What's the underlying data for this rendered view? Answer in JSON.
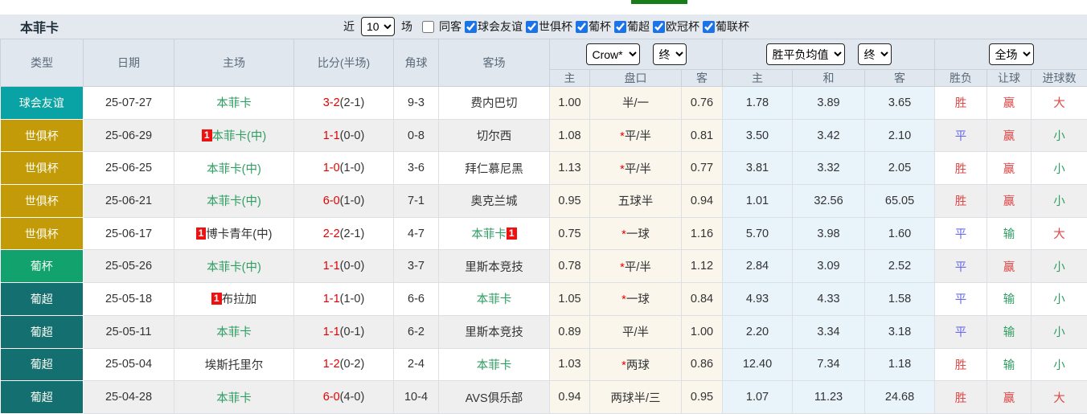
{
  "page": {
    "title": "本菲卡"
  },
  "filters": {
    "recent_label": "近",
    "recent_value": "10",
    "matches_label": "场",
    "away_filter": {
      "label": "同客",
      "checked": false
    },
    "competitions": [
      {
        "label": "球会友谊",
        "checked": true
      },
      {
        "label": "世俱杯",
        "checked": true
      },
      {
        "label": "葡杯",
        "checked": true
      },
      {
        "label": "葡超",
        "checked": true
      },
      {
        "label": "欧冠杯",
        "checked": true
      },
      {
        "label": "葡联杯",
        "checked": true
      }
    ]
  },
  "table": {
    "selects": {
      "company": "Crow*",
      "company_time": "终",
      "avg": "胜平负均值",
      "avg_time": "终",
      "period": "全场"
    },
    "col_headers": {
      "type": "类型",
      "date": "日期",
      "home": "主场",
      "score": "比分(半场)",
      "corners": "角球",
      "away": "客场",
      "ah_home": "主",
      "ah_line": "盘口",
      "ah_away": "客",
      "odds_home": "主",
      "odds_draw": "和",
      "odds_away": "客",
      "result_wdl": "胜负",
      "result_handicap": "让球",
      "result_goals": "进球数"
    },
    "rows": [
      {
        "type": "球会友谊",
        "type_color": "#09a3a5",
        "date": "25-07-27",
        "home": {
          "badge": "",
          "name": "本菲卡",
          "green": true
        },
        "score": {
          "main": "3-2",
          "half": "(2-1)"
        },
        "corners": "9-3",
        "away": {
          "name": "费内巴切",
          "green": false,
          "badge": ""
        },
        "ah": {
          "home": "1.00",
          "star": false,
          "line": "半/一",
          "away": "0.76"
        },
        "odds": {
          "home": "1.78",
          "draw": "3.89",
          "away": "3.65"
        },
        "res": {
          "wdl": {
            "t": "胜",
            "c": "red"
          },
          "handicap": {
            "t": "赢",
            "c": "red"
          },
          "goals": {
            "t": "大",
            "c": "red"
          }
        }
      },
      {
        "type": "世俱杯",
        "type_color": "#c39a08",
        "date": "25-06-29",
        "home": {
          "badge": "1",
          "name": "本菲卡(中)",
          "green": true
        },
        "score": {
          "main": "1-1",
          "half": "(0-0)"
        },
        "corners": "0-8",
        "away": {
          "name": "切尔西",
          "green": false,
          "badge": ""
        },
        "ah": {
          "home": "1.08",
          "star": true,
          "line": "平/半",
          "away": "0.81"
        },
        "odds": {
          "home": "3.50",
          "draw": "3.42",
          "away": "2.10"
        },
        "res": {
          "wdl": {
            "t": "平",
            "c": "blue"
          },
          "handicap": {
            "t": "赢",
            "c": "red"
          },
          "goals": {
            "t": "小",
            "c": "green"
          }
        }
      },
      {
        "type": "世俱杯",
        "type_color": "#c39a08",
        "date": "25-06-25",
        "home": {
          "badge": "",
          "name": "本菲卡(中)",
          "green": true
        },
        "score": {
          "main": "1-0",
          "half": "(1-0)"
        },
        "corners": "3-6",
        "away": {
          "name": "拜仁慕尼黑",
          "green": false,
          "badge": ""
        },
        "ah": {
          "home": "1.13",
          "star": true,
          "line": "平/半",
          "away": "0.77"
        },
        "odds": {
          "home": "3.81",
          "draw": "3.32",
          "away": "2.05"
        },
        "res": {
          "wdl": {
            "t": "胜",
            "c": "red"
          },
          "handicap": {
            "t": "赢",
            "c": "red"
          },
          "goals": {
            "t": "小",
            "c": "green"
          }
        }
      },
      {
        "type": "世俱杯",
        "type_color": "#c39a08",
        "date": "25-06-21",
        "home": {
          "badge": "",
          "name": "本菲卡(中)",
          "green": true
        },
        "score": {
          "main": "6-0",
          "half": "(1-0)"
        },
        "corners": "7-1",
        "away": {
          "name": "奥克兰城",
          "green": false,
          "badge": ""
        },
        "ah": {
          "home": "0.95",
          "star": false,
          "line": "五球半",
          "away": "0.94"
        },
        "odds": {
          "home": "1.01",
          "draw": "32.56",
          "away": "65.05"
        },
        "res": {
          "wdl": {
            "t": "胜",
            "c": "red"
          },
          "handicap": {
            "t": "赢",
            "c": "red"
          },
          "goals": {
            "t": "小",
            "c": "green"
          }
        }
      },
      {
        "type": "世俱杯",
        "type_color": "#c39a08",
        "date": "25-06-17",
        "home": {
          "badge": "1",
          "name": "博卡青年(中)",
          "green": false
        },
        "score": {
          "main": "2-2",
          "half": "(2-1)"
        },
        "corners": "4-7",
        "away": {
          "name": "本菲卡",
          "green": true,
          "badge": "1"
        },
        "ah": {
          "home": "0.75",
          "star": true,
          "line": "一球",
          "away": "1.16"
        },
        "odds": {
          "home": "5.70",
          "draw": "3.98",
          "away": "1.60"
        },
        "res": {
          "wdl": {
            "t": "平",
            "c": "blue"
          },
          "handicap": {
            "t": "输",
            "c": "green"
          },
          "goals": {
            "t": "大",
            "c": "red"
          }
        }
      },
      {
        "type": "葡杯",
        "type_color": "#12a26d",
        "date": "25-05-26",
        "home": {
          "badge": "",
          "name": "本菲卡(中)",
          "green": true
        },
        "score": {
          "main": "1-1",
          "half": "(0-0)"
        },
        "corners": "3-7",
        "away": {
          "name": "里斯本竞技",
          "green": false,
          "badge": ""
        },
        "ah": {
          "home": "0.78",
          "star": true,
          "line": "平/半",
          "away": "1.12"
        },
        "odds": {
          "home": "2.84",
          "draw": "3.09",
          "away": "2.52"
        },
        "res": {
          "wdl": {
            "t": "平",
            "c": "blue"
          },
          "handicap": {
            "t": "赢",
            "c": "red"
          },
          "goals": {
            "t": "小",
            "c": "green"
          }
        }
      },
      {
        "type": "葡超",
        "type_color": "#136f70",
        "date": "25-05-18",
        "home": {
          "badge": "1",
          "name": "布拉加",
          "green": false
        },
        "score": {
          "main": "1-1",
          "half": "(1-0)"
        },
        "corners": "6-6",
        "away": {
          "name": "本菲卡",
          "green": true,
          "badge": ""
        },
        "ah": {
          "home": "1.05",
          "star": true,
          "line": "一球",
          "away": "0.84"
        },
        "odds": {
          "home": "4.93",
          "draw": "4.33",
          "away": "1.58"
        },
        "res": {
          "wdl": {
            "t": "平",
            "c": "blue"
          },
          "handicap": {
            "t": "输",
            "c": "green"
          },
          "goals": {
            "t": "小",
            "c": "green"
          }
        }
      },
      {
        "type": "葡超",
        "type_color": "#136f70",
        "date": "25-05-11",
        "home": {
          "badge": "",
          "name": "本菲卡",
          "green": true
        },
        "score": {
          "main": "1-1",
          "half": "(0-1)"
        },
        "corners": "6-2",
        "away": {
          "name": "里斯本竞技",
          "green": false,
          "badge": ""
        },
        "ah": {
          "home": "0.89",
          "star": false,
          "line": "平/半",
          "away": "1.00"
        },
        "odds": {
          "home": "2.20",
          "draw": "3.34",
          "away": "3.18"
        },
        "res": {
          "wdl": {
            "t": "平",
            "c": "blue"
          },
          "handicap": {
            "t": "输",
            "c": "green"
          },
          "goals": {
            "t": "小",
            "c": "green"
          }
        }
      },
      {
        "type": "葡超",
        "type_color": "#136f70",
        "date": "25-05-04",
        "home": {
          "badge": "",
          "name": "埃斯托里尔",
          "green": false
        },
        "score": {
          "main": "1-2",
          "half": "(0-2)"
        },
        "corners": "2-4",
        "away": {
          "name": "本菲卡",
          "green": true,
          "badge": ""
        },
        "ah": {
          "home": "1.03",
          "star": true,
          "line": "两球",
          "away": "0.86"
        },
        "odds": {
          "home": "12.40",
          "draw": "7.34",
          "away": "1.18"
        },
        "res": {
          "wdl": {
            "t": "胜",
            "c": "red"
          },
          "handicap": {
            "t": "输",
            "c": "green"
          },
          "goals": {
            "t": "小",
            "c": "green"
          }
        }
      },
      {
        "type": "葡超",
        "type_color": "#136f70",
        "date": "25-04-28",
        "home": {
          "badge": "",
          "name": "本菲卡",
          "green": true
        },
        "score": {
          "main": "6-0",
          "half": "(4-0)"
        },
        "corners": "10-4",
        "away": {
          "name": "AVS俱乐部",
          "green": false,
          "badge": ""
        },
        "ah": {
          "home": "0.94",
          "star": false,
          "line": "两球半/三",
          "away": "0.95"
        },
        "odds": {
          "home": "1.07",
          "draw": "11.23",
          "away": "24.68"
        },
        "res": {
          "wdl": {
            "t": "胜",
            "c": "red"
          },
          "handicap": {
            "t": "赢",
            "c": "red"
          },
          "goals": {
            "t": "大",
            "c": "red"
          }
        }
      }
    ]
  }
}
